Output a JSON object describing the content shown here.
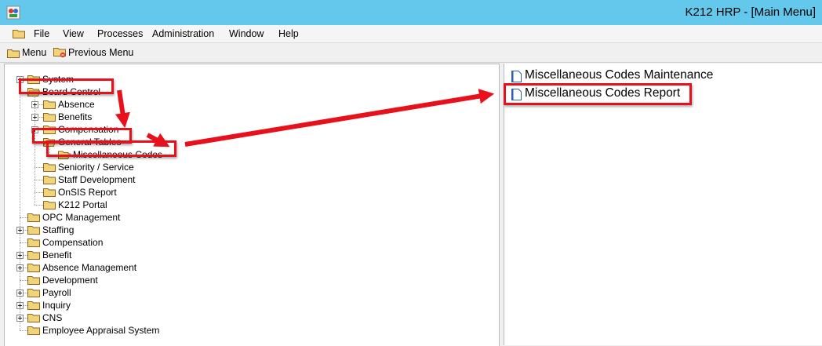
{
  "window": {
    "title": "K212 HRP - [Main Menu]"
  },
  "menubar": {
    "items": [
      "File",
      "View",
      "Processes",
      "Administration",
      "Window",
      "Help"
    ]
  },
  "toolbar": {
    "menu_label": "Menu",
    "previous_menu_label": "Previous Menu"
  },
  "tree": {
    "nodes": [
      {
        "label": "System",
        "expander": true
      },
      {
        "label": "Board Control",
        "expander": false,
        "state": "expanded"
      },
      {
        "label": "Absence",
        "expander": true
      },
      {
        "label": "Benefits",
        "expander": true
      },
      {
        "label": "Compensation",
        "expander": true
      },
      {
        "label": "General Tables",
        "expander": false,
        "state": "expanded"
      },
      {
        "label": "Miscellaneous Codes",
        "expander": false,
        "state": "selected"
      },
      {
        "label": "Seniority / Service",
        "expander": false
      },
      {
        "label": "Staff Development",
        "expander": false
      },
      {
        "label": "OnSIS Report",
        "expander": false
      },
      {
        "label": "K212 Portal",
        "expander": false
      },
      {
        "label": "OPC Management",
        "expander": false
      },
      {
        "label": "Staffing",
        "expander": true
      },
      {
        "label": "Compensation",
        "expander": false
      },
      {
        "label": "Benefit",
        "expander": true
      },
      {
        "label": "Absence Management",
        "expander": true
      },
      {
        "label": "Development",
        "expander": false
      },
      {
        "label": "Payroll",
        "expander": true
      },
      {
        "label": "Inquiry",
        "expander": true
      },
      {
        "label": "CNS",
        "expander": true
      },
      {
        "label": "Employee Appraisal System",
        "expander": false
      }
    ]
  },
  "right_panel": {
    "items": [
      {
        "label": "Miscellaneous Codes Maintenance"
      },
      {
        "label": "Miscellaneous Codes Report",
        "highlighted": true
      }
    ]
  },
  "colors": {
    "titlebar": "#63c8ec",
    "highlight": "#e8101a",
    "folder": "#f3d27a"
  }
}
